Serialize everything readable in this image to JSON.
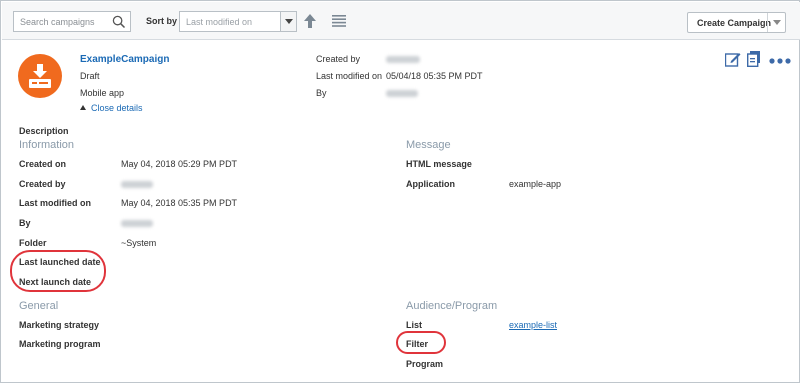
{
  "toolbar": {
    "search_placeholder": "Search campaigns",
    "sort_label": "Sort by",
    "sort_value": "Last modified on",
    "create_label": "Create Campaign"
  },
  "header": {
    "title": "ExampleCampaign",
    "status": "Draft",
    "channel": "Mobile app",
    "close_details": "Close details",
    "created_by_label": "Created by",
    "last_modified_label": "Last modified on",
    "last_modified_value": "05/04/18 05:35 PM PDT",
    "by_label": "By"
  },
  "description_label": "Description",
  "information": {
    "heading": "Information",
    "created_on_label": "Created on",
    "created_on_value": "May 04, 2018 05:29 PM PDT",
    "created_by_label": "Created by",
    "last_modified_label": "Last modified on",
    "last_modified_value": "May 04, 2018 05:35 PM PDT",
    "by_label": "By",
    "folder_label": "Folder",
    "folder_value": "~System",
    "last_launched_label": "Last launched date",
    "next_launch_label": "Next launch date"
  },
  "message": {
    "heading": "Message",
    "html_label": "HTML message",
    "application_label": "Application",
    "application_value": "example-app"
  },
  "general": {
    "heading": "General",
    "strategy_label": "Marketing strategy",
    "program_label": "Marketing program"
  },
  "audience": {
    "heading": "Audience/Program",
    "list_label": "List",
    "list_value": "example-list",
    "filter_label": "Filter",
    "program_label": "Program"
  },
  "colors": {
    "accent": "#1b6ab5",
    "logo": "#f06a1e",
    "highlight": "#e0343b",
    "section": "#8a9aa9"
  },
  "icons": [
    "search-icon",
    "chevron-down-icon",
    "arrow-up-icon",
    "list-icon",
    "download-icon",
    "edit-icon",
    "copy-icon",
    "more-icon"
  ]
}
